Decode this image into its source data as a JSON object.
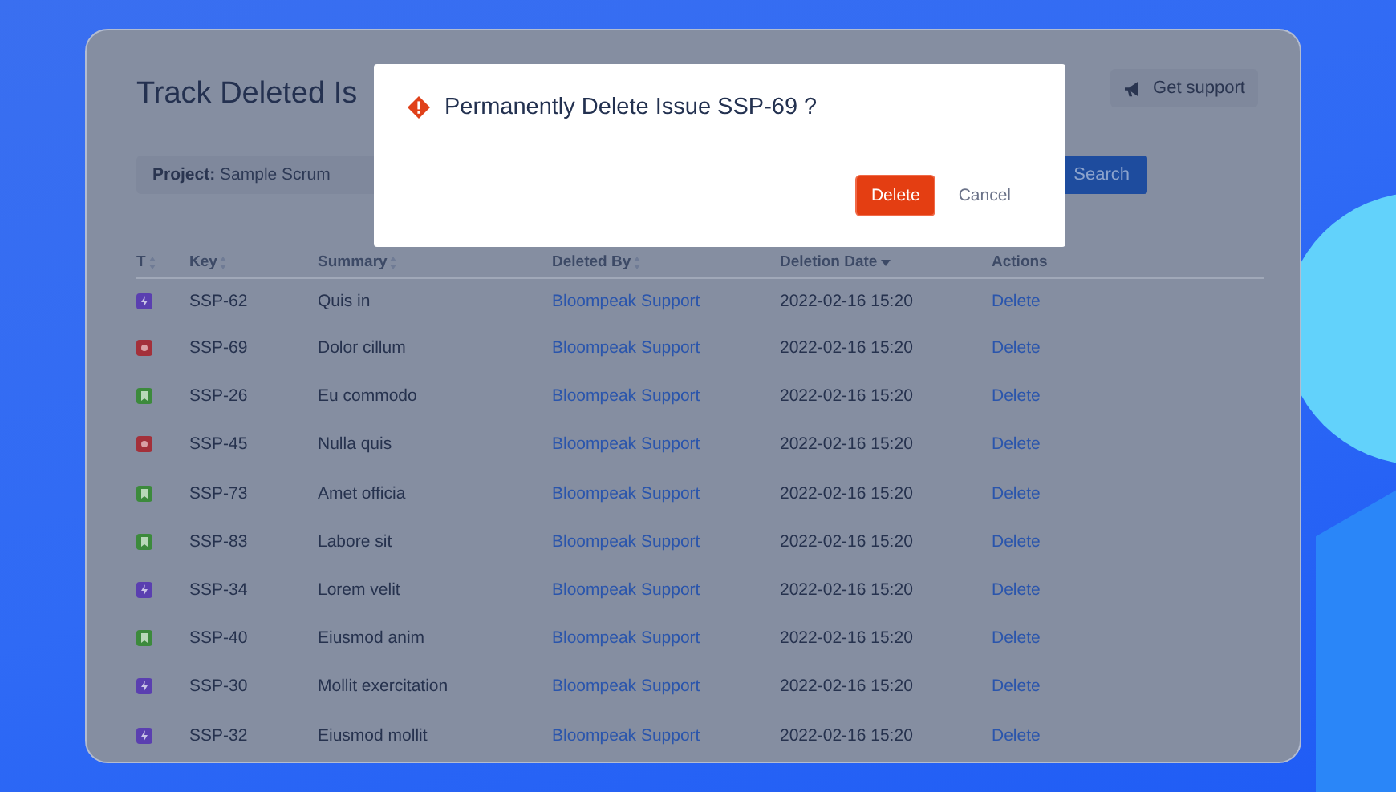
{
  "page": {
    "title": "Track Deleted Is",
    "support_button": "Get support"
  },
  "filter": {
    "label": "Project:",
    "value": "Sample Scrum",
    "search_button": "Search"
  },
  "table": {
    "columns": [
      {
        "label": "T",
        "sortable": true,
        "sorted": false
      },
      {
        "label": "Key",
        "sortable": true,
        "sorted": false
      },
      {
        "label": "Summary",
        "sortable": true,
        "sorted": false
      },
      {
        "label": "Deleted By",
        "sortable": true,
        "sorted": false
      },
      {
        "label": "Deletion Date",
        "sortable": true,
        "sorted": true
      },
      {
        "label": "Actions",
        "sortable": false,
        "sorted": false
      }
    ],
    "rows": [
      {
        "kind": "task",
        "key": "SSP-62",
        "summary": "Quis in",
        "deleted_by": "Bloompeak Support",
        "date": "2022-02-16 15:20",
        "action": "Delete"
      },
      {
        "kind": "bug",
        "key": "SSP-69",
        "summary": "Dolor cillum",
        "deleted_by": "Bloompeak Support",
        "date": "2022-02-16 15:20",
        "action": "Delete"
      },
      {
        "kind": "story",
        "key": "SSP-26",
        "summary": "Eu commodo",
        "deleted_by": "Bloompeak Support",
        "date": "2022-02-16 15:20",
        "action": "Delete"
      },
      {
        "kind": "bug",
        "key": "SSP-45",
        "summary": "Nulla quis",
        "deleted_by": "Bloompeak Support",
        "date": "2022-02-16 15:20",
        "action": "Delete"
      },
      {
        "kind": "story",
        "key": "SSP-73",
        "summary": "Amet officia",
        "deleted_by": "Bloompeak Support",
        "date": "2022-02-16 15:20",
        "action": "Delete"
      },
      {
        "kind": "story",
        "key": "SSP-83",
        "summary": "Labore sit",
        "deleted_by": "Bloompeak Support",
        "date": "2022-02-16 15:20",
        "action": "Delete"
      },
      {
        "kind": "task",
        "key": "SSP-34",
        "summary": "Lorem velit",
        "deleted_by": "Bloompeak Support",
        "date": "2022-02-16 15:20",
        "action": "Delete"
      },
      {
        "kind": "story",
        "key": "SSP-40",
        "summary": "Eiusmod anim",
        "deleted_by": "Bloompeak Support",
        "date": "2022-02-16 15:20",
        "action": "Delete"
      },
      {
        "kind": "task",
        "key": "SSP-30",
        "summary": "Mollit exercitation",
        "deleted_by": "Bloompeak Support",
        "date": "2022-02-16 15:20",
        "action": "Delete"
      },
      {
        "kind": "task",
        "key": "SSP-32",
        "summary": "Eiusmod mollit",
        "deleted_by": "Bloompeak Support",
        "date": "2022-02-16 15:20",
        "action": "Delete"
      }
    ]
  },
  "dialog": {
    "title": "Permanently Delete Issue SSP-69 ?",
    "confirm_button": "Delete",
    "cancel_button": "Cancel"
  }
}
